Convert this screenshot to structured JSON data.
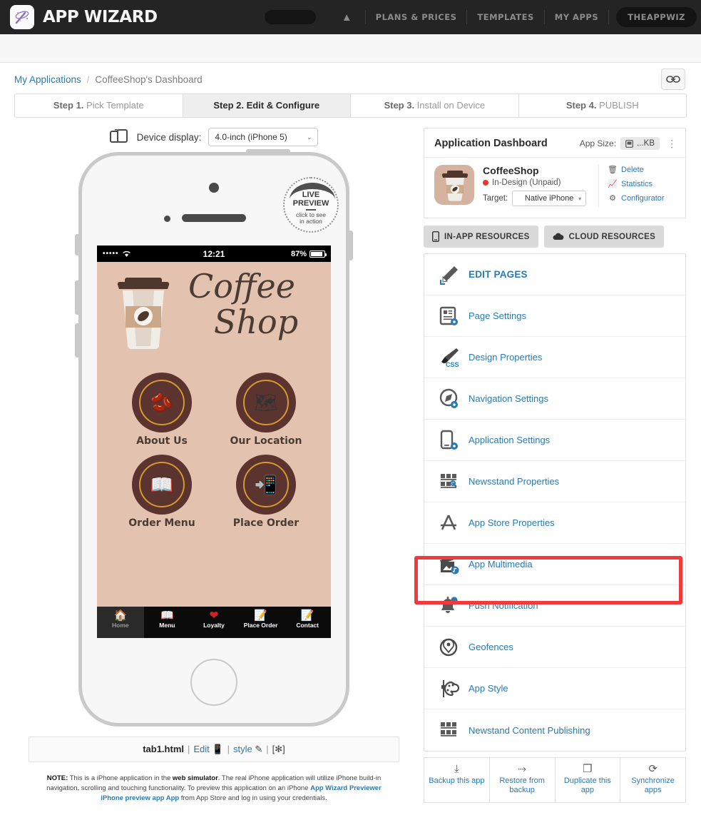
{
  "topnav": {
    "brand": "APP WIZARD",
    "logo_icon": "magic-wand-icon",
    "home_icon": "home-icon",
    "items": [
      "PLANS & PRICES",
      "TEMPLATES",
      "MY APPS"
    ],
    "user": "THEAPPWIZ"
  },
  "breadcrumb": {
    "root": "My Applications",
    "separator": "/",
    "current": "CoffeeShop's Dashboard",
    "link_button_icon": "link-chain-icon"
  },
  "steps": [
    {
      "num": "Step 1.",
      "label": " Pick Template",
      "active": false
    },
    {
      "num": "Step 2.",
      "label": " Edit & Configure",
      "active": true
    },
    {
      "num": "Step 3.",
      "label": " Install on Device",
      "active": false
    },
    {
      "num": "Step 4.",
      "label": " PUBLISH",
      "active": false
    }
  ],
  "device": {
    "icon": "device-switch-icon",
    "label": "Device display:",
    "selected": "4.0-inch (iPhone 5)",
    "chevron": "⌄"
  },
  "live_preview": {
    "line1": "LIVE",
    "line2": "PREVIEW",
    "line3": "click to see",
    "line4": "in action"
  },
  "phone_screen": {
    "status": {
      "signal": "•••••",
      "wifi": "◠",
      "time": "12:21",
      "battery": "87%"
    },
    "hero": {
      "logo_line1": "Coffee",
      "logo_line2": "Shop",
      "cup_icon": "coffee-cup-icon"
    },
    "tiles": [
      {
        "label": "About Us",
        "icon": "coffee-beans-icon",
        "glyph": "🫘"
      },
      {
        "label": "Our Location",
        "icon": "map-pin-icon",
        "glyph": "🗺"
      },
      {
        "label": "Order Menu",
        "icon": "open-book-icon",
        "glyph": "📖"
      },
      {
        "label": "Place Order",
        "icon": "tap-phone-icon",
        "glyph": "📲"
      }
    ],
    "tabbar": [
      {
        "label": "Home",
        "icon": "home-icon",
        "glyph": "🏠",
        "selected": true
      },
      {
        "label": "Menu",
        "icon": "book-icon",
        "glyph": "📖",
        "selected": false
      },
      {
        "label": "Loyalty",
        "icon": "heart-icon",
        "glyph": "❤",
        "selected": false
      },
      {
        "label": "Place Order",
        "icon": "tap-order-icon",
        "glyph": "📝",
        "selected": false
      },
      {
        "label": "Contact",
        "icon": "envelope-pencil-icon",
        "glyph": "📝",
        "selected": false
      }
    ]
  },
  "tabfile": {
    "filename": "tab1.html",
    "edit": "Edit",
    "edit_icon": "phone-icon",
    "style": "style",
    "style_icon": "pencil-icon",
    "gear": "[✻]",
    "sep": "|"
  },
  "note": {
    "prefix": "NOTE:",
    "text1": " This is a iPhone application in the ",
    "bold1": "web simulator",
    "text2": ". The real iPhone application will utilize iPhone build-in navigation, scrolling and touching functionality. To preview this application on an iPhone ",
    "link": "App Wizard Previewer iPhone preview app App",
    "text3": " from App Store and log in using your credentials."
  },
  "dashboard": {
    "title": "Application Dashboard",
    "app_size_label": "App Size:",
    "app_size_value": "...KB",
    "app_size_icon": "file-icon",
    "kebab_icon": "kebab-menu-icon",
    "app_name": "CoffeeShop",
    "app_status": "In-Design (Unpaid)",
    "status_color": "#e23b2e",
    "target_label": "Target:",
    "target_value": "Native iPhone",
    "app_icon": "coffee-cup-app-icon",
    "actions": [
      {
        "label": "Delete",
        "icon": "trash-icon",
        "glyph": "🗑"
      },
      {
        "label": "Statistics",
        "icon": "bar-chart-icon",
        "glyph": "📊"
      },
      {
        "label": "Configurator",
        "icon": "gear-icon",
        "glyph": "⚙"
      }
    ],
    "resource_tabs": [
      {
        "label": "IN-APP RESOURCES",
        "icon": "phone-icon",
        "glyph": "📱"
      },
      {
        "label": "CLOUD RESOURCES",
        "icon": "cloud-icon",
        "glyph": "☁"
      }
    ],
    "menu_items": [
      {
        "label": "EDIT PAGES",
        "icon": "pencil-icon",
        "glyph": "✎",
        "strong": true
      },
      {
        "label": "Page Settings",
        "icon": "page-settings-icon",
        "glyph": "📄",
        "strong": false
      },
      {
        "label": "Design Properties",
        "icon": "css-brush-icon",
        "glyph": "🖌",
        "strong": false
      },
      {
        "label": "Navigation Settings",
        "icon": "compass-gear-icon",
        "glyph": "🧭",
        "strong": false
      },
      {
        "label": "Application Settings",
        "icon": "phone-gear-icon",
        "glyph": "📱",
        "strong": false
      },
      {
        "label": "Newsstand Properties",
        "icon": "newsstand-search-icon",
        "glyph": "▤",
        "strong": false
      },
      {
        "label": "App Store Properties",
        "icon": "app-store-icon",
        "glyph": "🅐",
        "strong": false
      },
      {
        "label": "App Multimedia",
        "icon": "multimedia-icon",
        "glyph": "🎵",
        "strong": false,
        "highlighted": true
      },
      {
        "label": "Push Notification",
        "icon": "bell-icon",
        "glyph": "🔔",
        "strong": false
      },
      {
        "label": "Geofences",
        "icon": "geofence-icon",
        "glyph": "◎",
        "strong": false
      },
      {
        "label": "App Style",
        "icon": "palette-icon",
        "glyph": "🎨",
        "strong": false
      },
      {
        "label": "Newstand Content Publishing",
        "icon": "newsstand-icon",
        "glyph": "▤",
        "strong": false
      }
    ],
    "bottom_actions": [
      {
        "label": "Backup this app",
        "icon": "download-icon",
        "glyph": "⤓"
      },
      {
        "label": "Restore from backup",
        "icon": "upload-icon",
        "glyph": "⤑"
      },
      {
        "label": "Duplicate this app",
        "icon": "copy-icon",
        "glyph": "❐"
      },
      {
        "label": "Synchronize apps",
        "icon": "sync-icon",
        "glyph": "⟳"
      }
    ],
    "highlight_color": "#ef3b3b"
  }
}
